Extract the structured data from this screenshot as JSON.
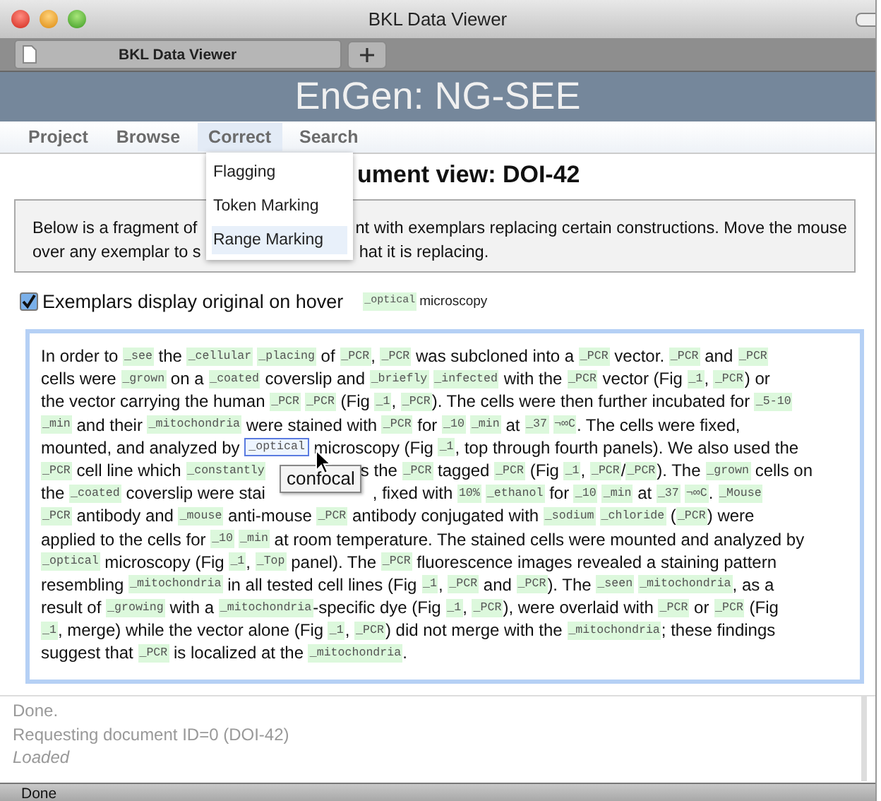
{
  "window": {
    "title": "BKL Data Viewer"
  },
  "tabs": [
    {
      "label": "BKL Data Viewer"
    }
  ],
  "header": {
    "title": "EnGen: NG-SEE"
  },
  "nav": [
    {
      "label": "Project",
      "selected": false
    },
    {
      "label": "Browse",
      "selected": false
    },
    {
      "label": "Correct",
      "selected": true
    },
    {
      "label": "Search",
      "selected": false
    }
  ],
  "menu": [
    {
      "label": "Flagging",
      "selected": false
    },
    {
      "label": "Token Marking",
      "selected": false
    },
    {
      "label": "Range Marking",
      "selected": true
    }
  ],
  "heading": "ument view: DOI-42",
  "info_lines": [
    [
      "Below is a fragment of ",
      "nt with exemplars replacing certain constructions. Move the mouse"
    ],
    [
      "over any exemplar to s",
      "hat it is replacing."
    ]
  ],
  "option": {
    "label": "Exemplars display original on hover",
    "checked": true,
    "example_token": "_optical",
    "example_text": "microscopy"
  },
  "paragraph": [
    [
      {
        "kind": "text",
        "s": "In order to "
      },
      {
        "kind": "token",
        "s": "_see"
      },
      {
        "kind": "text",
        "s": " the "
      },
      {
        "kind": "token",
        "s": "_cellular"
      },
      {
        "kind": "space"
      },
      {
        "kind": "token",
        "s": "_placing"
      },
      {
        "kind": "text",
        "s": " of "
      },
      {
        "kind": "token",
        "s": "_PCR"
      },
      {
        "kind": "text",
        "s": ", "
      },
      {
        "kind": "token",
        "s": "_PCR"
      },
      {
        "kind": "text",
        "s": " was subcloned into a "
      },
      {
        "kind": "token",
        "s": "_PCR"
      },
      {
        "kind": "text",
        "s": " vector. "
      },
      {
        "kind": "token",
        "s": "_PCR"
      },
      {
        "kind": "text",
        "s": " and "
      },
      {
        "kind": "token",
        "s": "_PCR"
      }
    ],
    [
      {
        "kind": "text",
        "s": "cells were "
      },
      {
        "kind": "token",
        "s": "_grown"
      },
      {
        "kind": "text",
        "s": " on a "
      },
      {
        "kind": "token",
        "s": "_coated"
      },
      {
        "kind": "text",
        "s": " coverslip and "
      },
      {
        "kind": "token",
        "s": "_briefly"
      },
      {
        "kind": "space"
      },
      {
        "kind": "token",
        "s": "_infected"
      },
      {
        "kind": "text",
        "s": " with the "
      },
      {
        "kind": "token",
        "s": "_PCR"
      },
      {
        "kind": "text",
        "s": " vector (Fig "
      },
      {
        "kind": "token",
        "s": "_1"
      },
      {
        "kind": "text",
        "s": ", "
      },
      {
        "kind": "token",
        "s": "_PCR"
      },
      {
        "kind": "text",
        "s": ") or"
      }
    ],
    [
      {
        "kind": "text",
        "s": "the vector carrying the human "
      },
      {
        "kind": "token",
        "s": "_PCR"
      },
      {
        "kind": "space"
      },
      {
        "kind": "token",
        "s": "_PCR"
      },
      {
        "kind": "text",
        "s": " (Fig "
      },
      {
        "kind": "token",
        "s": "_1"
      },
      {
        "kind": "text",
        "s": ", "
      },
      {
        "kind": "token",
        "s": "_PCR"
      },
      {
        "kind": "text",
        "s": "). The cells were then further incubated for "
      },
      {
        "kind": "token",
        "s": "_5-10"
      }
    ],
    [
      {
        "kind": "token",
        "s": "_min"
      },
      {
        "kind": "text",
        "s": " and their "
      },
      {
        "kind": "token",
        "s": "_mitochondria"
      },
      {
        "kind": "text",
        "s": " were stained with "
      },
      {
        "kind": "token",
        "s": "_PCR"
      },
      {
        "kind": "text",
        "s": " for "
      },
      {
        "kind": "token",
        "s": "_10"
      },
      {
        "kind": "space"
      },
      {
        "kind": "token",
        "s": "_min"
      },
      {
        "kind": "text",
        "s": " at "
      },
      {
        "kind": "token",
        "s": "_37"
      },
      {
        "kind": "space"
      },
      {
        "kind": "token",
        "s": "¬∞C"
      },
      {
        "kind": "text",
        "s": ". The cells were fixed,"
      }
    ],
    [
      {
        "kind": "text",
        "s": "mounted, and analyzed by "
      },
      {
        "kind": "token",
        "s": "_optical",
        "hovered": true
      },
      {
        "kind": "text",
        "s": " microscopy (Fig "
      },
      {
        "kind": "token",
        "s": "_1"
      },
      {
        "kind": "text",
        "s": ", top through fourth panels). We also used the"
      }
    ],
    [
      {
        "kind": "token",
        "s": "_PCR"
      },
      {
        "kind": "text",
        "s": " cell line which "
      },
      {
        "kind": "token",
        "s": "_constantly"
      },
      {
        "kind": "gap"
      },
      {
        "kind": "text",
        "s": "s the "
      },
      {
        "kind": "token",
        "s": "_PCR"
      },
      {
        "kind": "text",
        "s": " tagged "
      },
      {
        "kind": "token",
        "s": "_PCR"
      },
      {
        "kind": "text",
        "s": " (Fig "
      },
      {
        "kind": "token",
        "s": "_1"
      },
      {
        "kind": "text",
        "s": ", "
      },
      {
        "kind": "token",
        "s": "_PCR"
      },
      {
        "kind": "text",
        "s": "/"
      },
      {
        "kind": "token",
        "s": "_PCR"
      },
      {
        "kind": "text",
        "s": "). The "
      },
      {
        "kind": "token",
        "s": "_grown"
      },
      {
        "kind": "text",
        "s": " cells on"
      }
    ],
    [
      {
        "kind": "text",
        "s": "the "
      },
      {
        "kind": "token",
        "s": "_coated"
      },
      {
        "kind": "text",
        "s": " coverslip were stai"
      },
      {
        "kind": "gap"
      },
      {
        "kind": "text",
        "s": ", fixed with "
      },
      {
        "kind": "token",
        "s": "10%"
      },
      {
        "kind": "space"
      },
      {
        "kind": "token",
        "s": "_ethanol"
      },
      {
        "kind": "text",
        "s": " for "
      },
      {
        "kind": "token",
        "s": "_10"
      },
      {
        "kind": "space"
      },
      {
        "kind": "token",
        "s": "_min"
      },
      {
        "kind": "text",
        "s": " at "
      },
      {
        "kind": "token",
        "s": "_37"
      },
      {
        "kind": "space"
      },
      {
        "kind": "token",
        "s": "¬∞C"
      },
      {
        "kind": "text",
        "s": ". "
      },
      {
        "kind": "token",
        "s": "_Mouse"
      }
    ],
    [
      {
        "kind": "token",
        "s": "_PCR"
      },
      {
        "kind": "text",
        "s": " antibody and "
      },
      {
        "kind": "token",
        "s": "_mouse"
      },
      {
        "kind": "text",
        "s": " anti-mouse "
      },
      {
        "kind": "token",
        "s": "_PCR"
      },
      {
        "kind": "text",
        "s": " antibody conjugated with "
      },
      {
        "kind": "token",
        "s": "_sodium"
      },
      {
        "kind": "space"
      },
      {
        "kind": "token",
        "s": "_chloride"
      },
      {
        "kind": "text",
        "s": " ("
      },
      {
        "kind": "token",
        "s": "_PCR"
      },
      {
        "kind": "text",
        "s": ") were"
      }
    ],
    [
      {
        "kind": "text",
        "s": "applied to the cells for "
      },
      {
        "kind": "token",
        "s": "_10"
      },
      {
        "kind": "space"
      },
      {
        "kind": "token",
        "s": "_min"
      },
      {
        "kind": "text",
        "s": " at room temperature. The stained cells were mounted and analyzed by"
      }
    ],
    [
      {
        "kind": "token",
        "s": "_optical"
      },
      {
        "kind": "text",
        "s": " microscopy (Fig "
      },
      {
        "kind": "token",
        "s": "_1"
      },
      {
        "kind": "text",
        "s": ", "
      },
      {
        "kind": "token",
        "s": "_Top"
      },
      {
        "kind": "text",
        "s": " panel). The "
      },
      {
        "kind": "token",
        "s": "_PCR"
      },
      {
        "kind": "text",
        "s": " fluorescence images revealed a staining pattern"
      }
    ],
    [
      {
        "kind": "text",
        "s": "resembling "
      },
      {
        "kind": "token",
        "s": "_mitochondria"
      },
      {
        "kind": "text",
        "s": " in all tested cell lines (Fig "
      },
      {
        "kind": "token",
        "s": "_1"
      },
      {
        "kind": "text",
        "s": ", "
      },
      {
        "kind": "token",
        "s": "_PCR"
      },
      {
        "kind": "text",
        "s": " and "
      },
      {
        "kind": "token",
        "s": "_PCR"
      },
      {
        "kind": "text",
        "s": "). The "
      },
      {
        "kind": "token",
        "s": "_seen"
      },
      {
        "kind": "space"
      },
      {
        "kind": "token",
        "s": "_mitochondria"
      },
      {
        "kind": "text",
        "s": ", as a"
      }
    ],
    [
      {
        "kind": "text",
        "s": "result of "
      },
      {
        "kind": "token",
        "s": "_growing"
      },
      {
        "kind": "text",
        "s": " with a "
      },
      {
        "kind": "token",
        "s": "_mitochondria"
      },
      {
        "kind": "text",
        "s": "-specific dye (Fig "
      },
      {
        "kind": "token",
        "s": "_1"
      },
      {
        "kind": "text",
        "s": ", "
      },
      {
        "kind": "token",
        "s": "_PCR"
      },
      {
        "kind": "text",
        "s": "), were overlaid with "
      },
      {
        "kind": "token",
        "s": "_PCR"
      },
      {
        "kind": "text",
        "s": " or "
      },
      {
        "kind": "token",
        "s": "_PCR"
      },
      {
        "kind": "text",
        "s": " (Fig"
      }
    ],
    [
      {
        "kind": "token",
        "s": "_1"
      },
      {
        "kind": "text",
        "s": ", merge) while the vector alone (Fig "
      },
      {
        "kind": "token",
        "s": "_1"
      },
      {
        "kind": "text",
        "s": ", "
      },
      {
        "kind": "token",
        "s": "_PCR"
      },
      {
        "kind": "text",
        "s": ") did not merge with the "
      },
      {
        "kind": "token",
        "s": "_mitochondria"
      },
      {
        "kind": "text",
        "s": "; these findings"
      }
    ],
    [
      {
        "kind": "text",
        "s": "suggest that "
      },
      {
        "kind": "token",
        "s": "_PCR"
      },
      {
        "kind": "text",
        "s": " is localized at the "
      },
      {
        "kind": "token",
        "s": "_mitochondria"
      },
      {
        "kind": "text",
        "s": "."
      }
    ]
  ],
  "tooltip": "confocal",
  "log": [
    {
      "text": "Done.",
      "kind": "plain"
    },
    {
      "text": "Requesting document ID=0 (DOI-42)",
      "kind": "plain"
    },
    {
      "text": "Loaded",
      "kind": "italic"
    }
  ],
  "status_bar": "Done"
}
